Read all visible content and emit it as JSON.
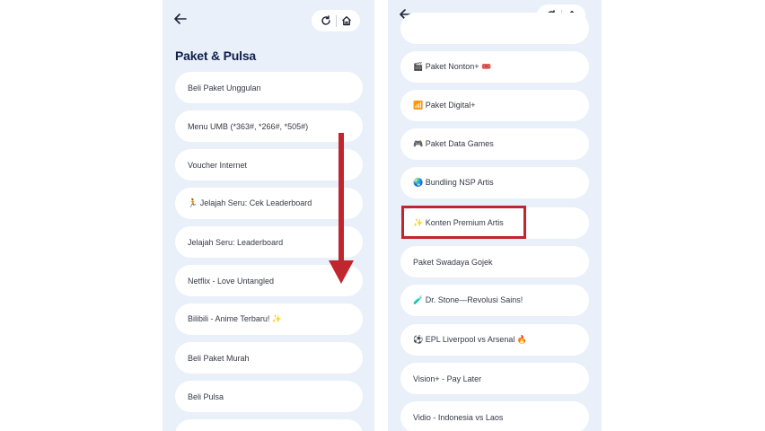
{
  "left_screen": {
    "title": "Paket & Pulsa",
    "items": [
      "Beli Paket Unggulan",
      "Menu UMB (*363#, *266#, *505#)",
      "Voucher Internet",
      "🏃 Jelajah Seru: Cek Leaderboard",
      "Jelajah Seru: Leaderboard",
      "Netflix - Love Untangled",
      "Bilibili - Anime Terbaru! ✨",
      "Beli Paket Murah",
      "Beli Pulsa",
      ""
    ]
  },
  "right_screen": {
    "items": [
      "",
      "🎬 Paket Nonton+ 🎟️",
      "📶 Paket Digital+",
      "🎮 Paket Data Games",
      "🌏 Bundling NSP Artis",
      "✨ Konten Premium Artis",
      "Paket Swadaya Gojek",
      "🧪 Dr. Stone—Revolusi Sains!",
      "⚽ EPL Liverpool vs Arsenal 🔥",
      "Vision+ - Pay Later",
      "Vidio - Indonesia vs Laos"
    ]
  },
  "annotations": {
    "arrow_color": "#c0262d",
    "highlight_color": "#c0262d",
    "highlighted_item": "✨ Konten Premium Artis"
  },
  "icons": {
    "back": "arrow-left-icon",
    "refresh": "refresh-icon",
    "home": "home-icon"
  }
}
